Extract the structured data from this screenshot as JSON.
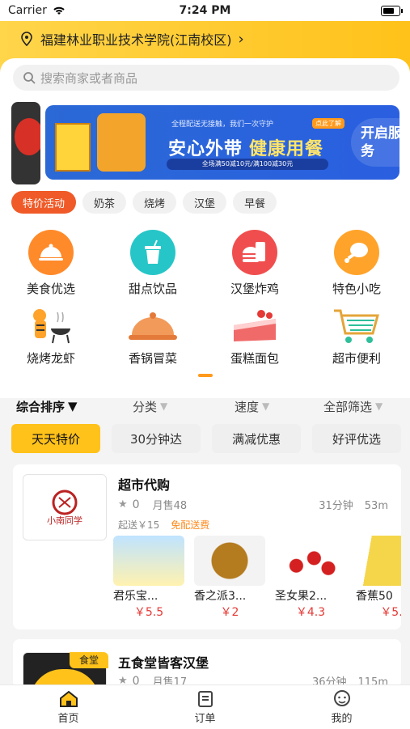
{
  "status": {
    "carrier": "Carrier",
    "time": "7:24 PM"
  },
  "location": {
    "text": "福建林业职业技术学院(江南校区)"
  },
  "search": {
    "placeholder": "搜索商家或者商品"
  },
  "banner": {
    "small_text": "全程配送无接触，我们一次守护",
    "title_white": "安心外带",
    "title_yellow": "健康用餐",
    "pill": "全场满50减10元/满100减30元",
    "tag": "点此了解",
    "cta": "开启服务"
  },
  "chips": [
    "特价活动",
    "奶茶",
    "烧烤",
    "汉堡",
    "早餐"
  ],
  "categories_row1": [
    "美食优选",
    "甜点饮品",
    "汉堡炸鸡",
    "特色小吃"
  ],
  "categories_row2": [
    "烧烤龙虾",
    "香锅冒菜",
    "蛋糕面包",
    "超市便利"
  ],
  "filters": [
    "综合排序",
    "分类",
    "速度",
    "全部筛选"
  ],
  "quick_tags": [
    "天天特价",
    "30分钟达",
    "满减优惠",
    "好评优选"
  ],
  "colors": {
    "accent": "#ffc21a",
    "hot": "#f05a28",
    "price": "#e53935"
  },
  "stores": [
    {
      "name": "超市代购",
      "logo_text": "小南同学",
      "rating": "0",
      "monthly_sales": "月售48",
      "eta": "31分钟",
      "distance": "53m",
      "min_order": "起送￥15",
      "delivery": "免配送费",
      "products": [
        {
          "name": "君乐宝...",
          "price": "￥5.5"
        },
        {
          "name": "香之派3...",
          "price": "￥2"
        },
        {
          "name": "圣女果2...",
          "price": "￥4.3"
        },
        {
          "name": "香蕉50",
          "price": "￥5."
        }
      ]
    },
    {
      "name": "五食堂皆客汉堡",
      "tag": "食堂",
      "rating": "0",
      "monthly_sales": "月售17",
      "eta": "36分钟",
      "distance": "115m"
    }
  ],
  "tabbar": [
    "首页",
    "订单",
    "我的"
  ]
}
